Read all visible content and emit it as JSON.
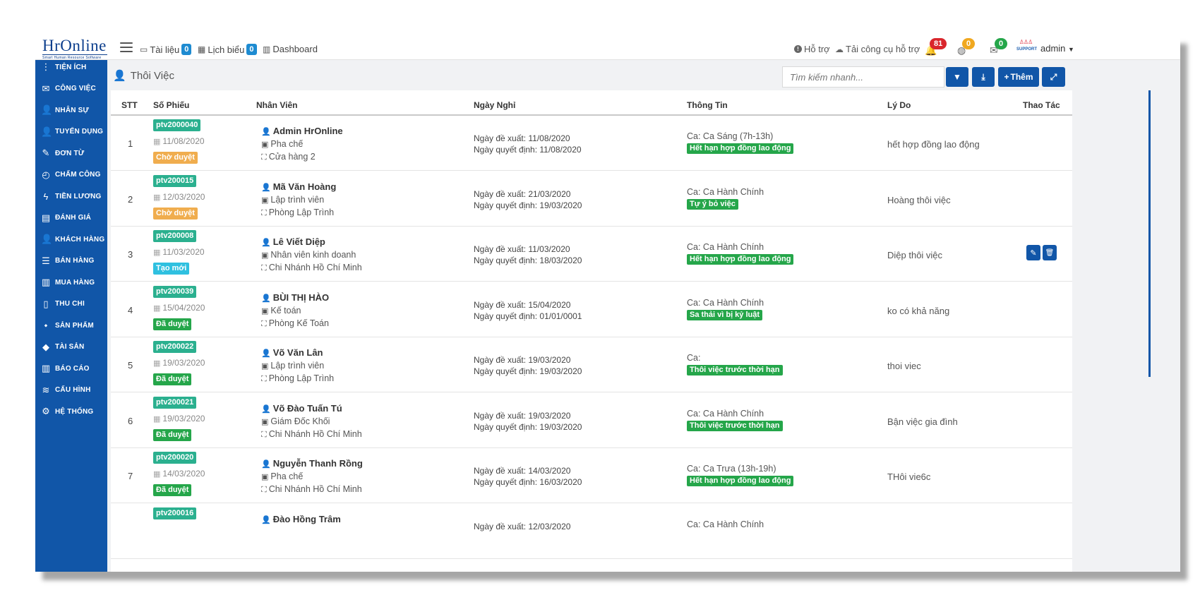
{
  "app": {
    "logo": "HrOnline",
    "logo_tagline": "Smart Human Resource Software"
  },
  "topnav": {
    "documents": {
      "label": "Tài liệu",
      "count": "0"
    },
    "schedule": {
      "label": "Lịch biểu",
      "count": "0"
    },
    "dashboard": {
      "label": "Dashboard"
    },
    "support": "Hỗ trợ",
    "download_tool": "Tải công cụ hỗ trợ",
    "notifications": [
      {
        "count": "81",
        "color": "#d9262c",
        "icon": "bell-icon"
      },
      {
        "count": "0",
        "color": "#f0a820",
        "icon": "globe-icon"
      },
      {
        "count": "0",
        "color": "#25a64a",
        "icon": "message-icon"
      }
    ],
    "avatar_text": "SUPPORT",
    "user": "admin"
  },
  "sidebar": {
    "items": [
      {
        "label": "TIỆN ÍCH",
        "icon": "more-vertical-icon",
        "glyph": "⋮"
      },
      {
        "label": "CÔNG VIỆC",
        "icon": "inbox-icon",
        "glyph": "✉"
      },
      {
        "label": "NHÂN SỰ",
        "icon": "user-icon",
        "glyph": "👤"
      },
      {
        "label": "TUYỂN DỤNG",
        "icon": "user-plus-icon",
        "glyph": "👤"
      },
      {
        "label": "ĐƠN TỪ",
        "icon": "edit-icon",
        "glyph": "✎"
      },
      {
        "label": "CHẤM CÔNG",
        "icon": "clock-icon",
        "glyph": "◴"
      },
      {
        "label": "TIỀN LƯƠNG",
        "icon": "lightning-icon",
        "glyph": "ϟ"
      },
      {
        "label": "ĐÁNH GIÁ",
        "icon": "book-icon",
        "glyph": "▤"
      },
      {
        "label": "KHÁCH HÀNG",
        "icon": "customer-icon",
        "glyph": "👤"
      },
      {
        "label": "BÁN HÀNG",
        "icon": "menu-icon",
        "glyph": "☰"
      },
      {
        "label": "MUA HÀNG",
        "icon": "map-icon",
        "glyph": "▥"
      },
      {
        "label": "THU CHI",
        "icon": "file-icon",
        "glyph": "▯"
      },
      {
        "label": "SẢN PHẨM",
        "icon": "tag-icon",
        "glyph": "⬩"
      },
      {
        "label": "TÀI SẢN",
        "icon": "diamond-icon",
        "glyph": "◆"
      },
      {
        "label": "BÁO CÁO",
        "icon": "bar-chart-icon",
        "glyph": "▥"
      },
      {
        "label": "CẤU HÌNH",
        "icon": "layers-icon",
        "glyph": "≋"
      },
      {
        "label": "HỆ THỐNG",
        "icon": "gear-icon",
        "glyph": "⚙"
      }
    ]
  },
  "page": {
    "title": "Thôi Việc",
    "search_placeholder": "Tìm kiếm nhanh...",
    "add_label": "Thêm"
  },
  "table": {
    "headers": {
      "stt": "STT",
      "code": "Số Phiếu",
      "employee": "Nhân Viên",
      "dates": "Ngày Nghỉ",
      "info": "Thông Tin",
      "reason": "Lý Do",
      "actions": "Thao Tác"
    },
    "rows": [
      {
        "stt": "1",
        "code": "ptv2000040",
        "date": "11/08/2020",
        "status": "Chờ duyệt",
        "status_color": "#f0ad4e",
        "name": "Admin HrOnline",
        "position": "Pha chế",
        "dept": "Cửa hàng 2",
        "proposed": "Ngày đề xuất: 11/08/2020",
        "decided": "Ngày quyết định: 11/08/2020",
        "shift": "Ca: Ca Sáng (7h-13h)",
        "type": "Hết hạn hợp đồng lao động",
        "reason": "hết hợp đồng lao động"
      },
      {
        "stt": "2",
        "code": "ptv200015",
        "date": "12/03/2020",
        "status": "Chờ duyệt",
        "status_color": "#f0ad4e",
        "name": "Mã Văn Hoàng",
        "position": "Lập trình viên",
        "dept": "Phòng Lập Trình",
        "proposed": "Ngày đề xuất: 21/03/2020",
        "decided": "Ngày quyết định: 19/03/2020",
        "shift": "Ca: Ca Hành Chính",
        "type": "Tự ý bỏ việc",
        "reason": "Hoàng thôi việc"
      },
      {
        "stt": "3",
        "code": "ptv200008",
        "date": "11/03/2020",
        "status": "Tạo mới",
        "status_color": "#2fc0e0",
        "name": "Lê Viết Diệp",
        "position": "Nhân viên kinh doanh",
        "dept": "Chi Nhánh Hồ Chí Minh",
        "proposed": "Ngày đề xuất: 11/03/2020",
        "decided": "Ngày quyết định: 18/03/2020",
        "shift": "Ca: Ca Hành Chính",
        "type": "Hết hạn hợp đồng lao động",
        "reason": "Diệp thôi việc",
        "actions": true
      },
      {
        "stt": "4",
        "code": "ptv200039",
        "date": "15/04/2020",
        "status": "Đã duyệt",
        "status_color": "#25a64a",
        "name": "BÙI THỊ HÀO",
        "position": "Kế toán",
        "dept": "Phòng Kế Toán",
        "proposed": "Ngày đề xuất: 15/04/2020",
        "decided": "Ngày quyết định: 01/01/0001",
        "shift": "Ca: Ca Hành Chính",
        "type": "Sa thải vì bị kỷ luật",
        "reason": "ko có khả năng"
      },
      {
        "stt": "5",
        "code": "ptv200022",
        "date": "19/03/2020",
        "status": "Đã duyệt",
        "status_color": "#25a64a",
        "name": "Võ Văn Lân",
        "position": "Lập trình viên",
        "dept": "Phòng Lập Trình",
        "proposed": "Ngày đề xuất: 19/03/2020",
        "decided": "Ngày quyết định: 19/03/2020",
        "shift": "Ca:",
        "type": "Thôi việc trước thời hạn",
        "reason": "thoi viec"
      },
      {
        "stt": "6",
        "code": "ptv200021",
        "date": "19/03/2020",
        "status": "Đã duyệt",
        "status_color": "#25a64a",
        "name": "Võ Đào Tuấn Tú",
        "position": "Giám Đốc Khối",
        "dept": "Chi Nhánh Hồ Chí Minh",
        "proposed": "Ngày đề xuất: 19/03/2020",
        "decided": "Ngày quyết định: 19/03/2020",
        "shift": "Ca: Ca Hành Chính",
        "type": "Thôi việc trước thời hạn",
        "reason": "Bận việc gia đình"
      },
      {
        "stt": "7",
        "code": "ptv200020",
        "date": "14/03/2020",
        "status": "Đã duyệt",
        "status_color": "#25a64a",
        "name": "Nguyễn Thanh Rồng",
        "position": "Pha chế",
        "dept": "Chi Nhánh Hồ Chí Minh",
        "proposed": "Ngày đề xuất: 14/03/2020",
        "decided": "Ngày quyết định: 16/03/2020",
        "shift": "Ca: Ca Trưa (13h-19h)",
        "type": "Hết hạn hợp đồng lao động",
        "reason": "THôi vie6c"
      },
      {
        "stt": "",
        "code": "ptv200016",
        "date": "",
        "status": "",
        "status_color": "#25a64a",
        "name": "Đào Hồng Trâm",
        "position": "",
        "dept": "",
        "proposed": "Ngày đề xuất: 12/03/2020",
        "decided": "",
        "shift": "Ca: Ca Hành Chính",
        "type": "",
        "reason": ""
      }
    ]
  }
}
